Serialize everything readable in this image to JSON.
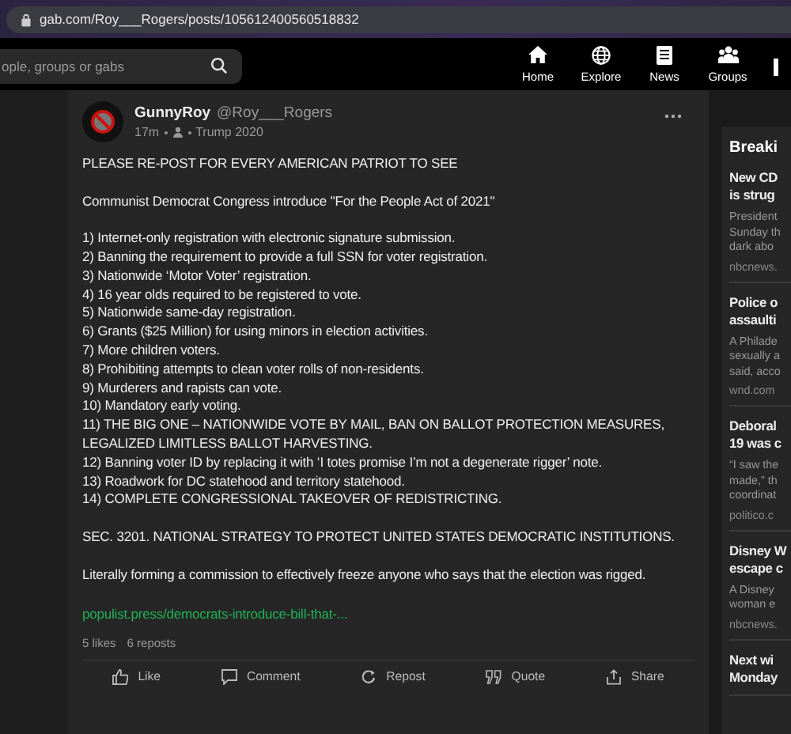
{
  "browser": {
    "url": "gab.com/Roy___Rogers/posts/105612400560518832"
  },
  "topbar": {
    "search": {
      "placeholder": "ople, groups or gabs"
    },
    "nav": [
      {
        "label": "Home",
        "kind": "home"
      },
      {
        "label": "Explore",
        "kind": "explore"
      },
      {
        "label": "News",
        "kind": "news"
      },
      {
        "label": "Groups",
        "kind": "groups"
      },
      {
        "kind": "more"
      }
    ]
  },
  "post": {
    "display_name": "GunnyRoy",
    "handle": "@Roy___Rogers",
    "time": "17m",
    "group": "Trump 2020",
    "paragraphs": [
      [
        "PLEASE RE-POST FOR EVERY AMERICAN PATRIOT TO SEE"
      ],
      [
        "Communist Democrat Congress introduce \"For the People Act of 2021\""
      ],
      [
        "1) Internet-only registration with electronic signature submission.",
        "2) Banning the requirement to provide a full SSN for voter registration.",
        "3) Nationwide ‘Motor Voter’ registration.",
        "4) 16 year olds required to be registered to vote.",
        "5) Nationwide same-day registration.",
        "6) Grants ($25 Million) for using minors in election activities.",
        "7) More children voters.",
        "8) Prohibiting attempts to clean voter rolls of non-residents.",
        "9) Murderers and rapists can vote.",
        "10) Mandatory early voting.",
        "11) THE BIG ONE – NATIONWIDE VOTE BY MAIL, BAN ON BALLOT PROTECTION MEASURES, LEGALIZED LIMITLESS BALLOT HARVESTING.",
        "12) Banning voter ID by replacing it with ‘I totes promise I’m not a degenerate rigger’ note.",
        "13) Roadwork for DC statehood and territory statehood.",
        "14) COMPLETE CONGRESSIONAL TAKEOVER OF REDISTRICTING."
      ],
      [
        "SEC. 3201. NATIONAL STRATEGY TO PROTECT UNITED STATES DEMOCRATIC INSTITUTIONS."
      ],
      [
        "Literally forming a commission to effectively freeze anyone who says that the election was rigged."
      ]
    ],
    "link": "populist.press/democrats-introduce-bill-that-...",
    "likes": "5 likes",
    "reposts": "6 reposts",
    "actions": [
      {
        "label": "Like",
        "kind": "like"
      },
      {
        "label": "Comment",
        "kind": "comment"
      },
      {
        "label": "Repost",
        "kind": "repost"
      },
      {
        "label": "Quote",
        "kind": "quote"
      },
      {
        "label": "Share",
        "kind": "share"
      }
    ]
  },
  "sidebar": {
    "heading": "Breaki",
    "news": [
      {
        "title": [
          "New CD",
          "is strug"
        ],
        "excerpt": [
          "President",
          "Sunday th",
          "dark abo"
        ],
        "source": "nbcnews."
      },
      {
        "title": [
          "Police o",
          "assaulti"
        ],
        "excerpt": [
          "A Philade",
          "sexually a",
          "said, acco"
        ],
        "source": "wnd.com"
      },
      {
        "title": [
          "Deboral",
          "19 was c"
        ],
        "excerpt": [
          "“I saw the",
          "made,” th",
          "coordinat"
        ],
        "source": "politico.c"
      },
      {
        "title": [
          "Disney W",
          "escape c"
        ],
        "excerpt": [
          "A Disney",
          "woman e"
        ],
        "source": "nbcnews."
      },
      {
        "title": [
          "Next wi",
          "Monday"
        ]
      }
    ]
  }
}
